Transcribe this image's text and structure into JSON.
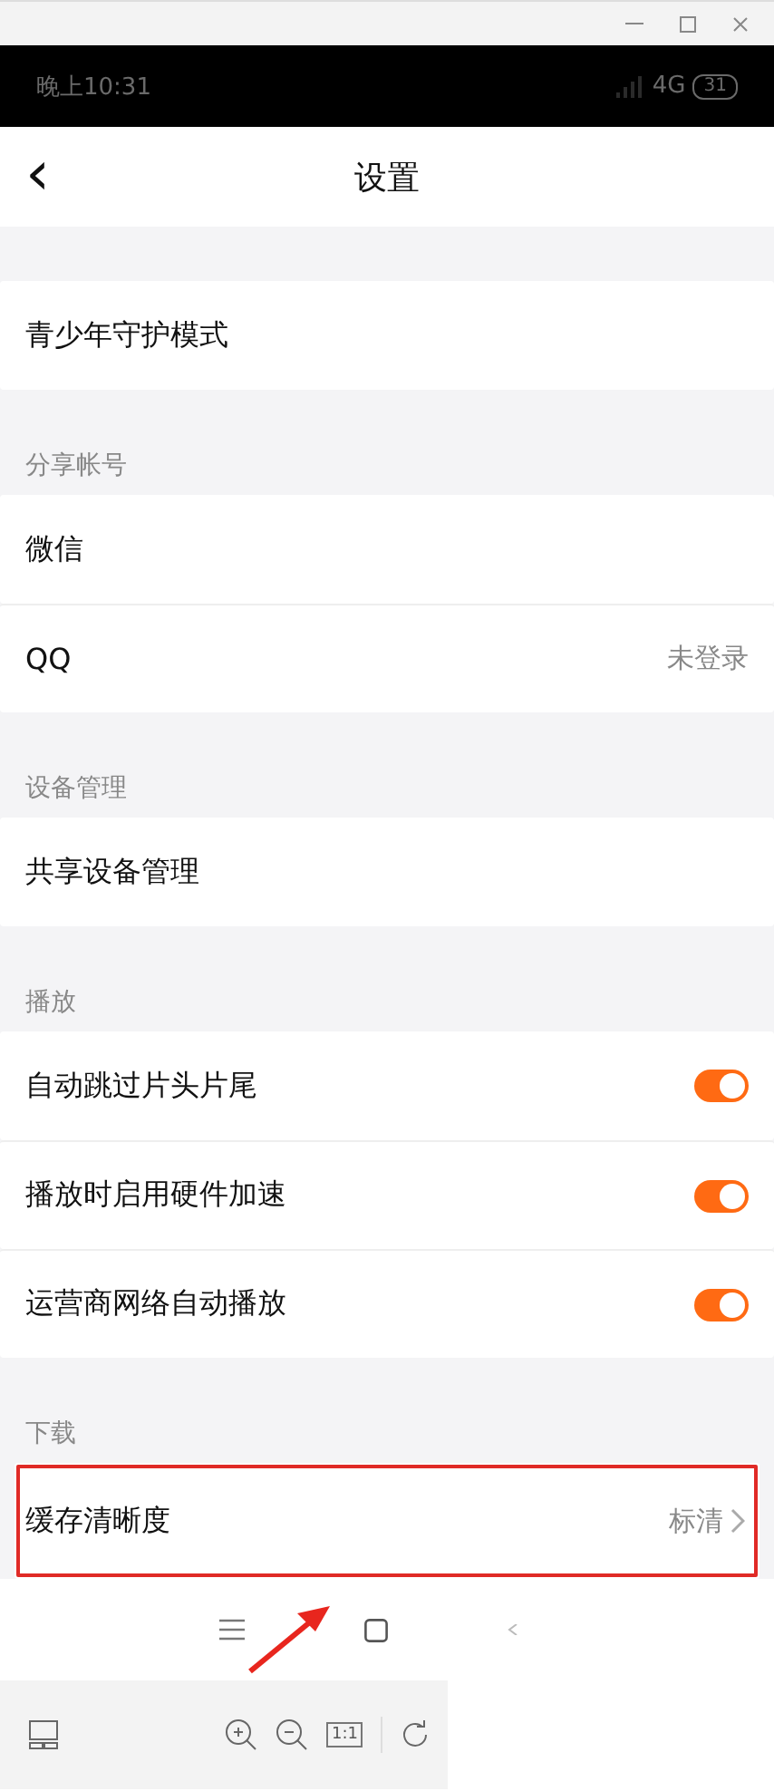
{
  "status_bar": {
    "time": "晚上10:31",
    "network": "4G",
    "battery": "31"
  },
  "header": {
    "back": "‹",
    "title": "设置"
  },
  "sections": [
    {
      "rows": [
        {
          "kind": "link",
          "label": "青少年守护模式"
        }
      ]
    },
    {
      "label": "分享帐号",
      "rows": [
        {
          "kind": "link",
          "label": "微信"
        },
        {
          "kind": "value",
          "label": "QQ",
          "value": "未登录"
        }
      ]
    },
    {
      "label": "设备管理",
      "rows": [
        {
          "kind": "link",
          "label": "共享设备管理"
        }
      ]
    },
    {
      "label": "播放",
      "rows": [
        {
          "kind": "toggle",
          "label": "自动跳过片头片尾",
          "on": true
        },
        {
          "kind": "toggle",
          "label": "播放时启用硬件加速",
          "on": true
        },
        {
          "kind": "toggle",
          "label": "运营商网络自动播放",
          "on": true
        }
      ]
    },
    {
      "label": "下载",
      "rows": [
        {
          "kind": "value",
          "label": "缓存清晰度",
          "value": "标清",
          "chevron": true,
          "highlighted": true
        }
      ]
    }
  ],
  "viewer_toolbar": {
    "actual_size": "1:1"
  }
}
